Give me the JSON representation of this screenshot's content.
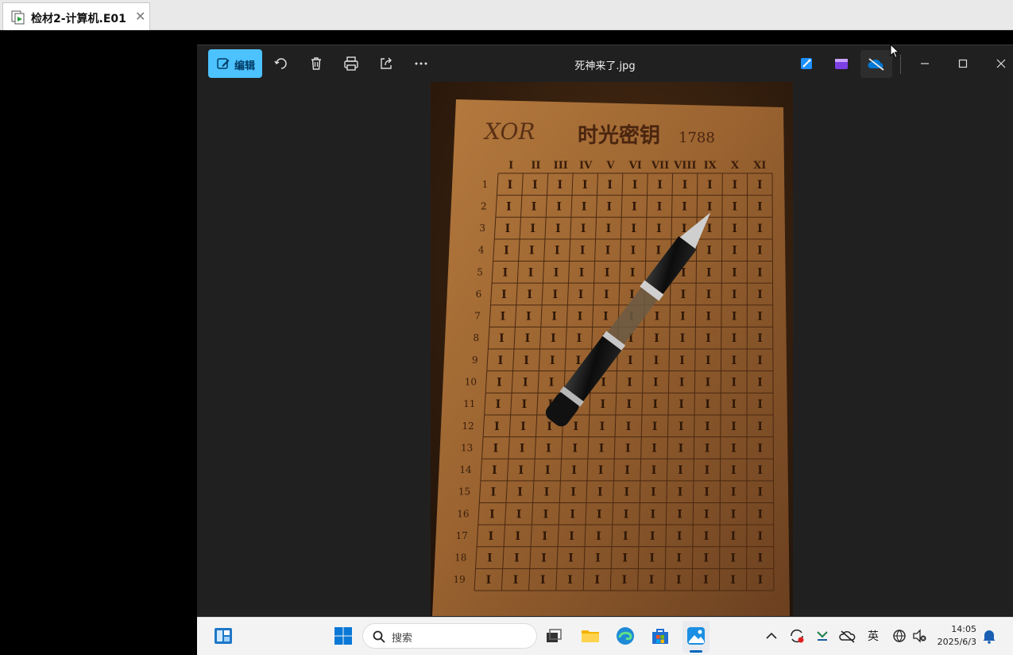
{
  "outer_tab": {
    "title": "检材2-计算机.E01"
  },
  "viewer": {
    "edit_label": "编辑",
    "file_title": "死神来了.jpg"
  },
  "photo": {
    "heading_left": "XOR",
    "heading_title": "时光密钥",
    "heading_number": "1788",
    "column_labels": [
      "I",
      "II",
      "III",
      "IV",
      "V",
      "VI",
      "VII",
      "VIII",
      "IX",
      "X",
      "XI"
    ],
    "row_labels": [
      "1",
      "2",
      "3",
      "4",
      "5",
      "6",
      "7",
      "8",
      "9",
      "10",
      "11",
      "12",
      "13",
      "14",
      "15",
      "16",
      "17",
      "18",
      "19"
    ],
    "cell_mark": "I"
  },
  "taskbar": {
    "search_placeholder": "搜索",
    "ime_label": "英",
    "time": "14:05",
    "date": "2025/6/3"
  },
  "colors": {
    "accent": "#4cc2ff",
    "viewer_bg": "#202020",
    "taskbar_bg": "#f3f3f3"
  }
}
